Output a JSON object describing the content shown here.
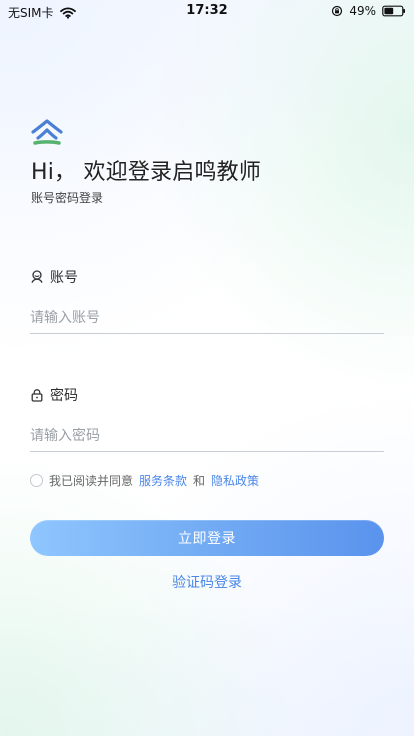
{
  "status_bar": {
    "carrier": "无SIM卡",
    "time": "17:32",
    "battery_percent": "49%"
  },
  "brand": {
    "logo_icon": "brand-logo-icon",
    "colors": {
      "blue": "#4a7fd6",
      "green": "#56b26f"
    }
  },
  "header": {
    "welcome_title": "Hi， 欢迎登录启鸣教师",
    "subtitle": "账号密码登录"
  },
  "form": {
    "account": {
      "label": "账号",
      "placeholder": "请输入账号",
      "value": "",
      "icon": "user-icon"
    },
    "password": {
      "label": "密码",
      "placeholder": "请输入密码",
      "value": "",
      "icon": "lock-icon"
    }
  },
  "agreement": {
    "prefix": "我已阅读并同意",
    "terms_link": "服务条款",
    "connector": "和",
    "privacy_link": "隐私政策",
    "checked": false
  },
  "actions": {
    "login_button": "立即登录",
    "code_login_link": "验证码登录"
  },
  "colors": {
    "accent": "#4a86e8",
    "button_start": "#8fc6ff",
    "button_end": "#5a93ed",
    "text_primary": "#222222",
    "text_secondary": "#666666"
  }
}
